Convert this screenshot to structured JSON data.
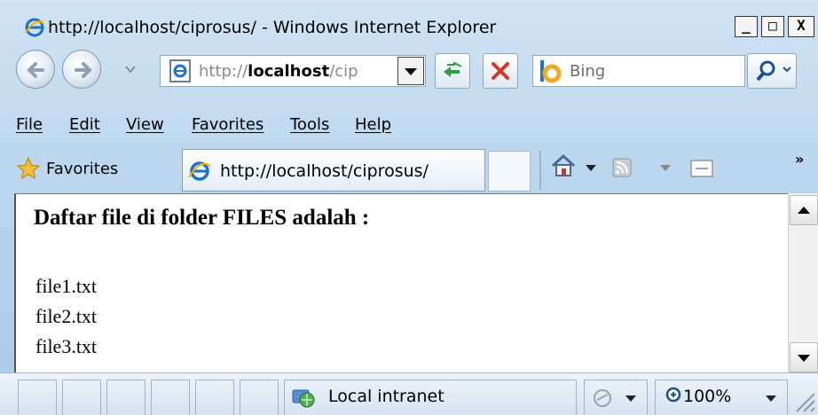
{
  "window": {
    "title": "http://localhost/ciprosus/ - Windows Internet Explorer",
    "minimize_glyph": "_",
    "maximize_glyph": "□",
    "close_glyph": "X"
  },
  "navbar": {
    "address_prefix": "http://",
    "address_host": "localhost",
    "address_tail": "/cip",
    "search_placeholder": "Bing",
    "icons": [
      "back-icon",
      "forward-icon",
      "refresh-icon",
      "stop-icon",
      "bing-icon",
      "search-icon"
    ]
  },
  "menu": {
    "items": [
      "File",
      "Edit",
      "View",
      "Favorites",
      "Tools",
      "Help"
    ]
  },
  "favorites_bar": {
    "favorites_label": "Favorites",
    "tab_title": "http://localhost/ciprosus/",
    "overflow_glyph": "»"
  },
  "page": {
    "heading": "Daftar file di folder FILES adalah :",
    "files": [
      "file1.txt",
      "file2.txt",
      "file3.txt"
    ]
  },
  "status": {
    "zone": "Local intranet",
    "zoom": "100%"
  },
  "colors": {
    "chrome_bg": "#bcd7ee",
    "stop_red": "#d9342b",
    "refresh_green": "#2e9e3a",
    "ie_blue": "#1c73c9",
    "bing_orange": "#f5a623"
  }
}
